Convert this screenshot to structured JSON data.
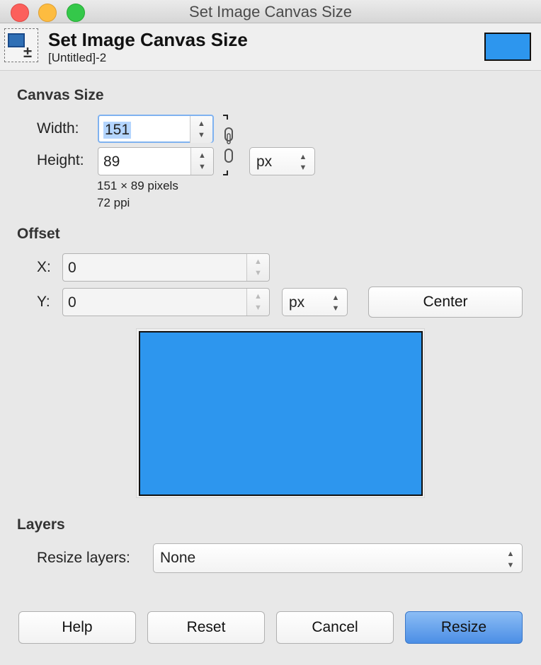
{
  "window": {
    "title": "Set Image Canvas Size"
  },
  "header": {
    "title": "Set Image Canvas Size",
    "subtitle": "[Untitled]-2",
    "swatch_color": "#2d96ee"
  },
  "canvas_size": {
    "section_label": "Canvas Size",
    "width_label": "Width:",
    "width_value": "151",
    "height_label": "Height:",
    "height_value": "89",
    "unit": "px",
    "pixels_info": "151 × 89 pixels",
    "ppi_info": "72 ppi",
    "chain_icon": "chain-link-icon"
  },
  "offset": {
    "section_label": "Offset",
    "x_label": "X:",
    "x_value": "0",
    "y_label": "Y:",
    "y_value": "0",
    "unit": "px",
    "center_label": "Center"
  },
  "preview": {
    "fill_color": "#2d96ee"
  },
  "layers": {
    "section_label": "Layers",
    "resize_label": "Resize layers:",
    "resize_value": "None"
  },
  "buttons": {
    "help": "Help",
    "reset": "Reset",
    "cancel": "Cancel",
    "resize": "Resize"
  }
}
